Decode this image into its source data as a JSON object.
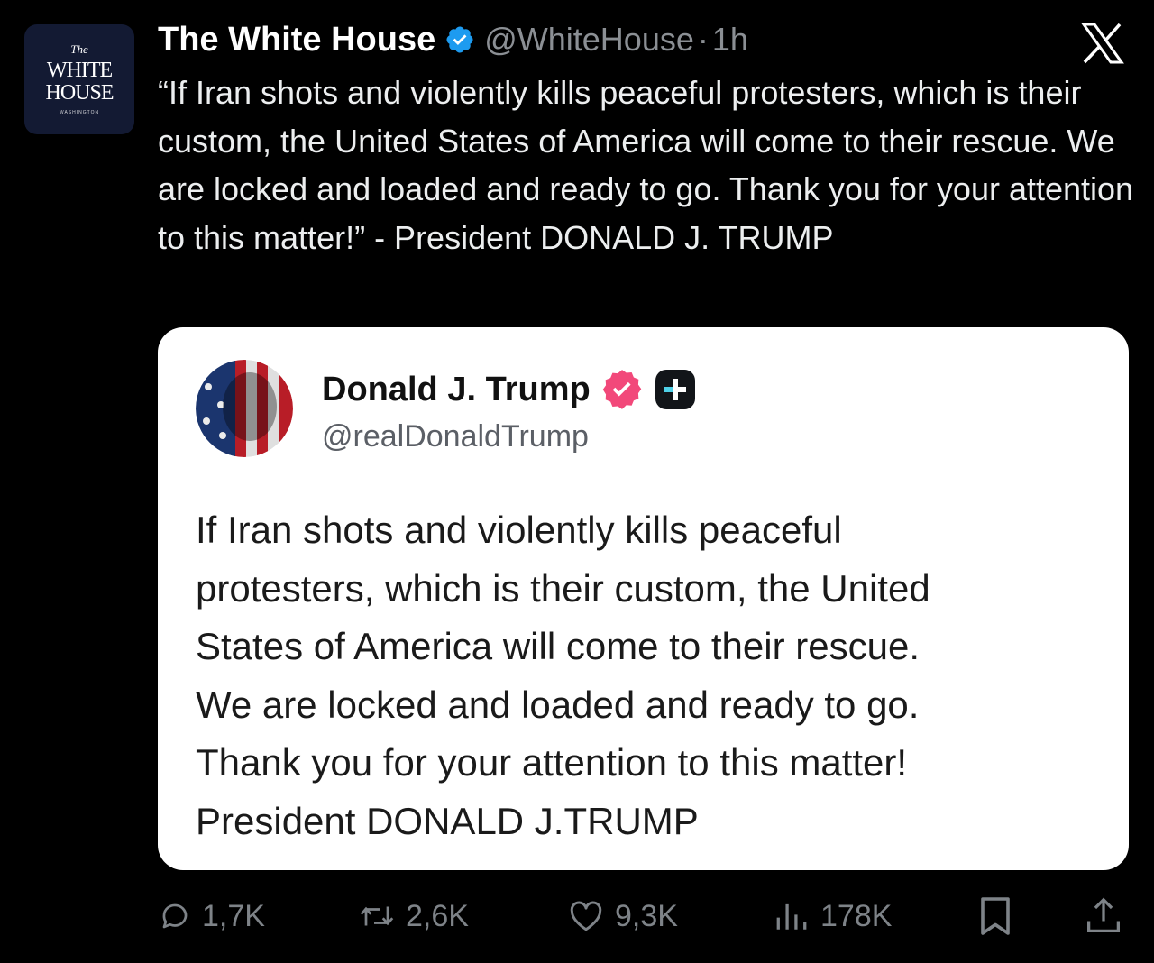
{
  "account": {
    "logo_line1": "The",
    "logo_line2": "WHITE",
    "logo_line3": "HOUSE",
    "logo_line4": "WASHINGTON",
    "name": "The White House",
    "handle": "@WhiteHouse",
    "separator": "·",
    "time": "1h"
  },
  "tweet": {
    "text": "“If Iran shots and violently kills peaceful protesters, which is their custom, the United States of America will come to their rescue. We are locked and loaded and ready to go. Thank you for your attention to this matter!” - President DONALD J. TRUMP"
  },
  "quoted": {
    "name": "Donald J. Trump",
    "handle": "@realDonaldTrump",
    "lines": [
      "If Iran shots and violently kills peaceful",
      "protesters, which is their custom, the United",
      "States of America will come to their rescue.",
      "We are locked and loaded and ready to go.",
      "Thank you for your attention to this matter!",
      "President DONALD J.TRUMP"
    ]
  },
  "actions": {
    "replies": "1,7K",
    "reposts": "2,6K",
    "likes": "9,3K",
    "views": "178K"
  },
  "colors": {
    "background": "#000000",
    "verified_blue": "#1d9bf0",
    "truth_badge": "#f2487a",
    "muted": "#7e8388"
  },
  "icons": [
    "verified-badge-icon",
    "x-logo-icon",
    "reply-icon",
    "repost-icon",
    "like-icon",
    "views-icon",
    "bookmark-icon",
    "share-icon",
    "truth-verified-icon",
    "truth-plus-icon"
  ]
}
